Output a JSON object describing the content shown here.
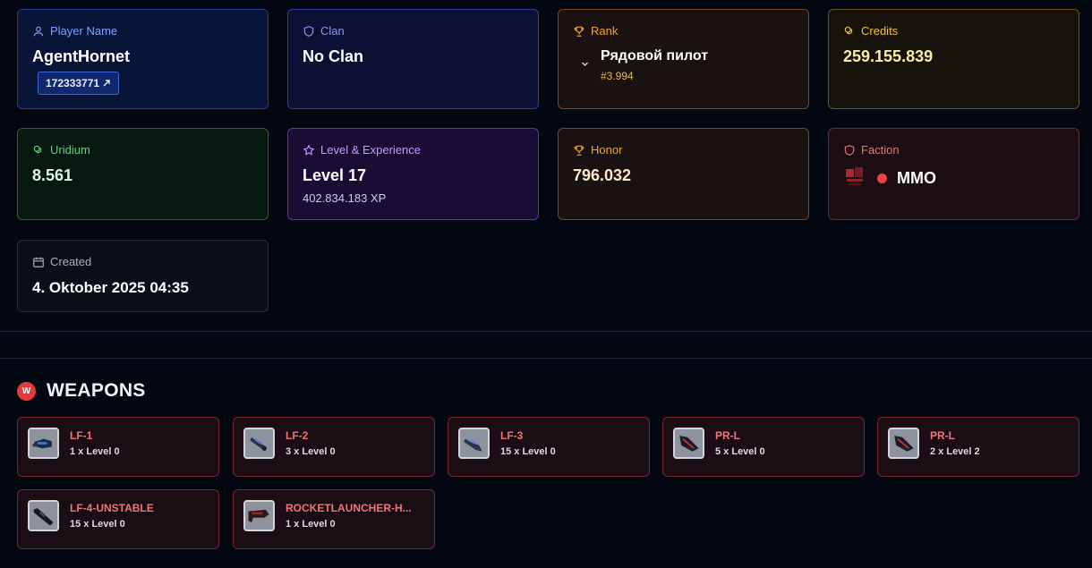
{
  "cards": {
    "player": {
      "label": "Player Name",
      "value": "AgentHornet",
      "id": "172333771",
      "id_icon": "external-link-icon"
    },
    "clan": {
      "label": "Clan",
      "value": "No Clan"
    },
    "rank": {
      "label": "Rank",
      "value": "Рядовой пилот",
      "sub": "#3.994"
    },
    "credits": {
      "label": "Credits",
      "value": "259.155.839"
    },
    "uridium": {
      "label": "Uridium",
      "value": "8.561"
    },
    "level": {
      "label": "Level & Experience",
      "value": "Level 17",
      "sub": "402.834.183 XP"
    },
    "honor": {
      "label": "Honor",
      "value": "796.032"
    },
    "faction": {
      "label": "Faction",
      "value": "MMO",
      "dot_color": "#ef4444"
    },
    "created": {
      "label": "Created",
      "value": "4. Oktober 2025 04:35"
    }
  },
  "weapons_section": {
    "icon_letter": "W",
    "title": "WEAPONS"
  },
  "weapons": [
    {
      "name": "LF-1",
      "count": "1 x Level 0",
      "icon": "laser-cannon-icon"
    },
    {
      "name": "LF-2",
      "count": "3 x Level 0",
      "icon": "laser-cannon-icon"
    },
    {
      "name": "LF-3",
      "count": "15 x Level 0",
      "icon": "laser-cannon-icon"
    },
    {
      "name": "PR-L",
      "count": "5 x Level 0",
      "icon": "rocket-launcher-icon"
    },
    {
      "name": "PR-L",
      "count": "2 x Level 2",
      "icon": "rocket-launcher-icon"
    },
    {
      "name": "LF-4-UNSTABLE",
      "count": "15 x Level 0",
      "icon": "laser-cannon-icon"
    },
    {
      "name": "ROCKETLAUNCHER-H...",
      "count": "1 x Level 0",
      "icon": "rocket-launcher-icon"
    }
  ]
}
